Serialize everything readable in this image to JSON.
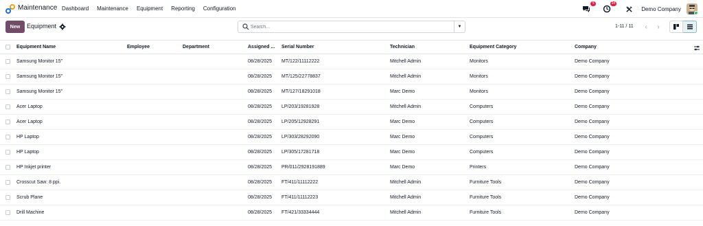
{
  "navbar": {
    "app_name": "Maintenance",
    "menu": [
      "Dashboard",
      "Maintenance",
      "Equipment",
      "Reporting",
      "Configuration"
    ],
    "messages_badge": "5",
    "activity_badge": "24",
    "company": "Demo Company"
  },
  "control": {
    "new_label": "New",
    "breadcrumb": "Equipment",
    "search_placeholder": "Search...",
    "pager": "1-11 / 11"
  },
  "table": {
    "headers": [
      "Equipment Name",
      "Employee",
      "Department",
      "Assigned ...",
      "Serial Number",
      "Technician",
      "Equipment Category",
      "Company"
    ],
    "rows": [
      {
        "name": "Samsung Monitor 15\"",
        "employee": "",
        "department": "",
        "assigned": "08/28/2025",
        "serial": "MT/122/11112222",
        "technician": "Mitchell Admin",
        "category": "Monitors",
        "company": "Demo Company"
      },
      {
        "name": "Samsung Monitor 15\"",
        "employee": "",
        "department": "",
        "assigned": "08/28/2025",
        "serial": "MT/125/22778837",
        "technician": "Mitchell Admin",
        "category": "Monitors",
        "company": "Demo Company"
      },
      {
        "name": "Samsung Monitor 15\"",
        "employee": "",
        "department": "",
        "assigned": "08/28/2025",
        "serial": "MT/127/18291018",
        "technician": "Marc Demo",
        "category": "Monitors",
        "company": "Demo Company"
      },
      {
        "name": "Acer Laptop",
        "employee": "",
        "department": "",
        "assigned": "08/28/2025",
        "serial": "LP/203/19281928",
        "technician": "Mitchell Admin",
        "category": "Computers",
        "company": "Demo Company"
      },
      {
        "name": "Acer Laptop",
        "employee": "",
        "department": "",
        "assigned": "08/28/2025",
        "serial": "LP/205/12928291",
        "technician": "Marc Demo",
        "category": "Computers",
        "company": "Demo Company"
      },
      {
        "name": "HP Laptop",
        "employee": "",
        "department": "",
        "assigned": "08/28/2025",
        "serial": "LP/303/28292090",
        "technician": "Marc Demo",
        "category": "Computers",
        "company": "Demo Company"
      },
      {
        "name": "HP Laptop",
        "employee": "",
        "department": "",
        "assigned": "08/28/2025",
        "serial": "LP/305/17281718",
        "technician": "Marc Demo",
        "category": "Computers",
        "company": "Demo Company"
      },
      {
        "name": "HP Inkjet printer",
        "employee": "",
        "department": "",
        "assigned": "08/28/2025",
        "serial": "PR/011/2928191889",
        "technician": "Marc Demo",
        "category": "Printers",
        "company": "Demo Company"
      },
      {
        "name": "Crosscut Saw: 8 ppi.",
        "employee": "",
        "department": "",
        "assigned": "08/28/2025",
        "serial": "FT/411/11112222",
        "technician": "Mitchell Admin",
        "category": "Furniture Tools",
        "company": "Demo Company"
      },
      {
        "name": "Scrub Plane",
        "employee": "",
        "department": "",
        "assigned": "08/28/2025",
        "serial": "FT/411/11112223",
        "technician": "Mitchell Admin",
        "category": "Furniture Tools",
        "company": "Demo Company"
      },
      {
        "name": "Drill Machine",
        "employee": "",
        "department": "",
        "assigned": "08/28/2025",
        "serial": "FT/421/33334444",
        "technician": "Mitchell Admin",
        "category": "Furniture Tools",
        "company": "Demo Company"
      }
    ]
  },
  "colors": {
    "brand": "#714b67",
    "badge": "#e11d48",
    "active_view": "#e6f2f3"
  },
  "icons": [
    "maintenance-logo-icon",
    "chat-icon",
    "clock-activity-icon",
    "tools-icon",
    "gear-icon",
    "search-icon",
    "caret-down-icon",
    "chevron-left-icon",
    "chevron-right-icon",
    "kanban-view-icon",
    "list-view-icon",
    "optional-columns-icon"
  ]
}
